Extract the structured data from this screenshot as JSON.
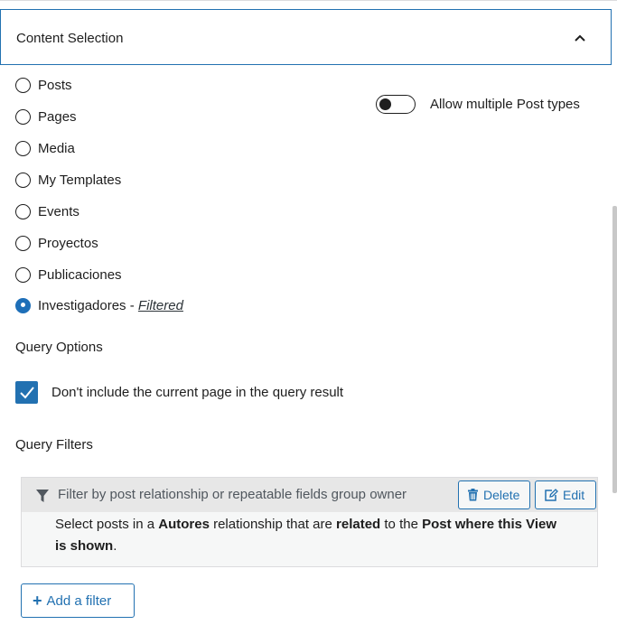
{
  "panel": {
    "title": "Content Selection"
  },
  "post_types": [
    {
      "label": "Posts",
      "selected": false
    },
    {
      "label": "Pages",
      "selected": false
    },
    {
      "label": "Media",
      "selected": false
    },
    {
      "label": "My Templates",
      "selected": false
    },
    {
      "label": "Events",
      "selected": false
    },
    {
      "label": "Proyectos",
      "selected": false
    },
    {
      "label": "Publicaciones",
      "selected": false
    },
    {
      "label": "Investigadores",
      "selected": true
    }
  ],
  "selected_suffix": " - ",
  "filtered_link": "Filtered",
  "toggle": {
    "label": "Allow multiple Post types",
    "on": false
  },
  "query_options": {
    "heading": "Query Options",
    "exclude_current_label": "Don't include the current page in the query result",
    "exclude_current_checked": true
  },
  "query_filters": {
    "heading": "Query Filters",
    "filter_title": "Filter by post relationship or repeatable fields group owner",
    "delete_label": "Delete",
    "edit_label": "Edit",
    "desc": {
      "p1": "Select posts in a ",
      "b1": "Autores",
      "p2": " relationship that are ",
      "b2": "related",
      "p3": " to the ",
      "b3": "Post where this View is shown",
      "p4": "."
    },
    "add_label": "Add a filter"
  },
  "colors": {
    "accent": "#2271b1",
    "text": "#1e1e1e",
    "filter_header_bg": "#e7e7e7"
  }
}
